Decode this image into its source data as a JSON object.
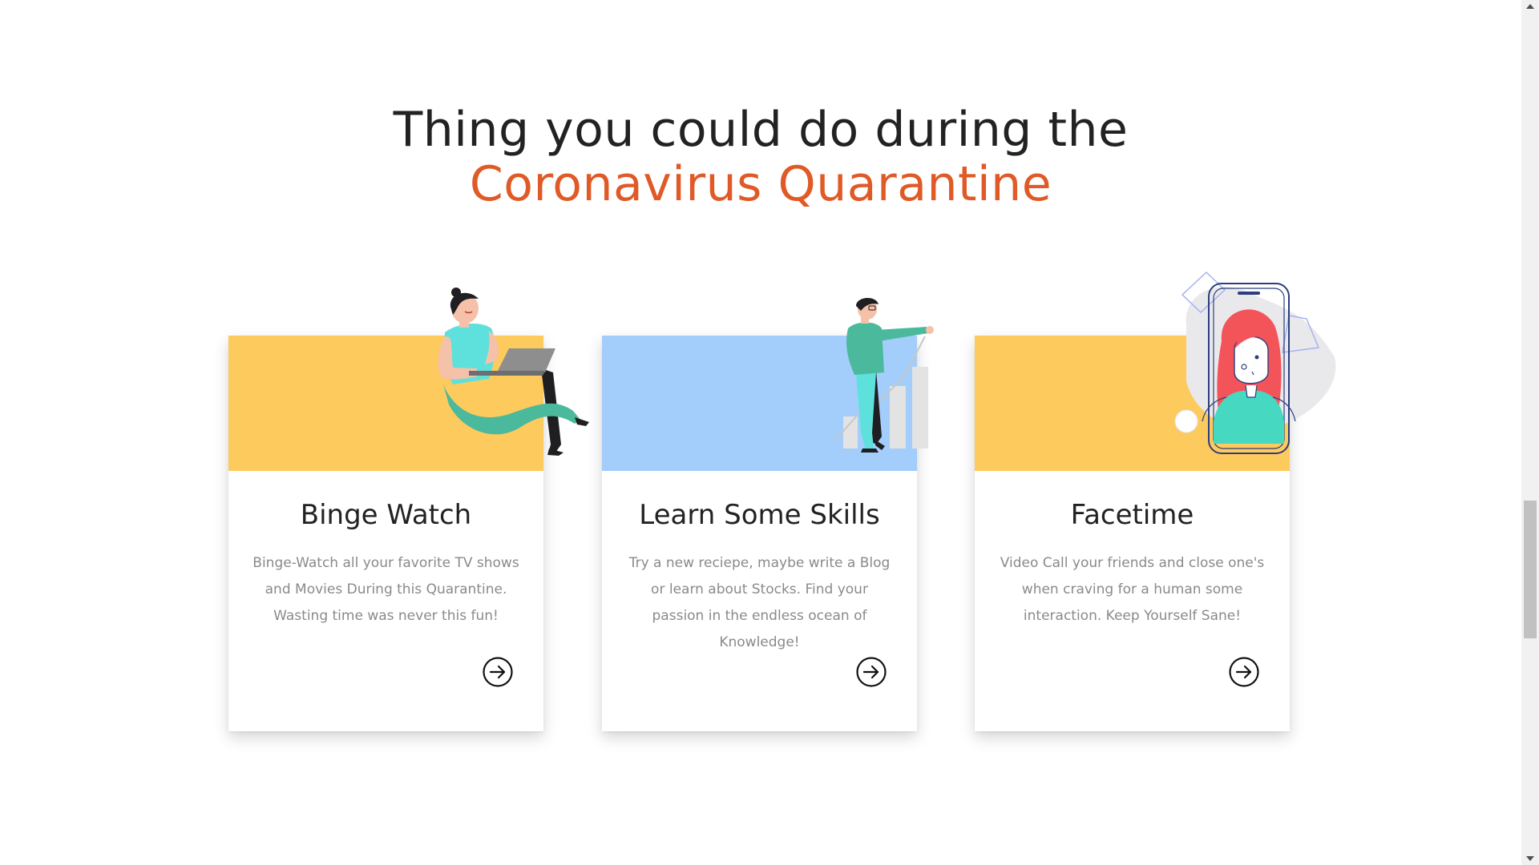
{
  "heading": {
    "line1": "Thing you could do during the",
    "line2": "Coronavirus Quarantine"
  },
  "colors": {
    "heading_text": "#222222",
    "accent_orange": "#e05a27",
    "banner_yellow": "#fdca5e",
    "banner_blue": "#a3cdfb",
    "description_gray": "#8a8a8a"
  },
  "cards": [
    {
      "title": "Binge Watch",
      "description": "Binge-Watch all your favorite TV shows and Movies During this Quarantine. Wasting time was never this fun!",
      "banner_color": "#fdca5e",
      "illustration": "woman-with-laptop-illustration",
      "action_icon": "arrow-right-circle-icon"
    },
    {
      "title": "Learn Some Skills",
      "description": "Try a new reciepe, maybe write a Blog or learn about Stocks. Find your passion in the endless ocean of Knowledge!",
      "banner_color": "#a3cdfb",
      "illustration": "man-with-growth-chart-illustration",
      "action_icon": "arrow-right-circle-icon"
    },
    {
      "title": "Facetime",
      "description": "Video Call your friends and close one's when craving for a human some interaction. Keep Yourself Sane!",
      "banner_color": "#fdca5e",
      "illustration": "video-call-phone-illustration",
      "action_icon": "arrow-right-circle-icon"
    }
  ]
}
